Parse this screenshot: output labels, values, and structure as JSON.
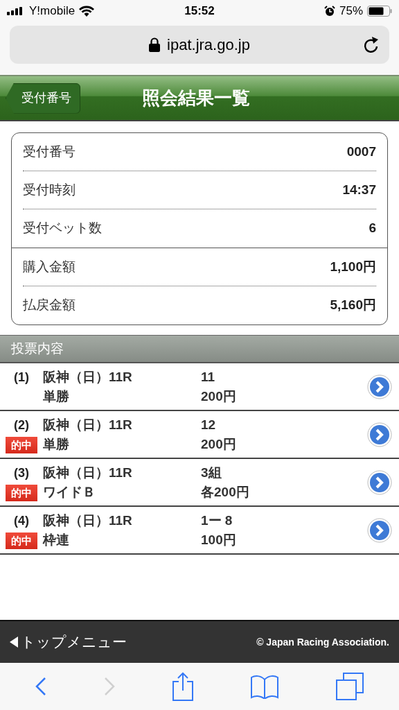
{
  "status_bar": {
    "carrier": "Y!mobile",
    "time": "15:52",
    "battery": "75%"
  },
  "url_bar": {
    "url": "ipat.jra.go.jp"
  },
  "header": {
    "back_label": "受付番号",
    "title": "照会結果一覧"
  },
  "summary": {
    "groups": [
      [
        {
          "label": "受付番号",
          "value": "0007"
        },
        {
          "label": "受付時刻",
          "value": "14:37"
        },
        {
          "label": "受付ベット数",
          "value": "6"
        }
      ],
      [
        {
          "label": "購入金額",
          "value": "1,100円"
        },
        {
          "label": "払戻金額",
          "value": "5,160円"
        }
      ]
    ]
  },
  "section_title": "投票内容",
  "bets": [
    {
      "number": "(1)",
      "hit": false,
      "race": "阪神（日）11R",
      "type": "単勝",
      "selection": "11",
      "amount": "200円"
    },
    {
      "number": "(2)",
      "hit": true,
      "hit_label": "的中",
      "race": "阪神（日）11R",
      "type": "単勝",
      "selection": "12",
      "amount": "200円"
    },
    {
      "number": "(3)",
      "hit": true,
      "hit_label": "的中",
      "race": "阪神（日）11R",
      "type": "ワイドＢ",
      "selection": "3組",
      "amount": "各200円"
    },
    {
      "number": "(4)",
      "hit": true,
      "hit_label": "的中",
      "race": "阪神（日）11R",
      "type": "枠連",
      "selection": "1ー 8",
      "amount": "100円"
    }
  ],
  "footer": {
    "menu_link": "トップメニュー",
    "copyright": "© Japan Racing Association."
  },
  "toolbar": {
    "back_enabled": true,
    "forward_enabled": false
  }
}
